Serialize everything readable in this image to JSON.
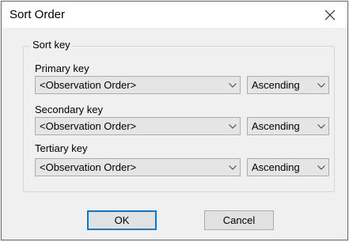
{
  "window": {
    "title": "Sort Order"
  },
  "group": {
    "label": "Sort key"
  },
  "keys": [
    {
      "label": "Primary key",
      "field": "<Observation Order>",
      "order": "Ascending"
    },
    {
      "label": "Secondary key",
      "field": "<Observation Order>",
      "order": "Ascending"
    },
    {
      "label": "Tertiary key",
      "field": "<Observation Order>",
      "order": "Ascending"
    }
  ],
  "buttons": {
    "ok": "OK",
    "cancel": "Cancel"
  },
  "icons": {
    "close": "close-icon",
    "dropdown": "chevron-down-icon"
  }
}
